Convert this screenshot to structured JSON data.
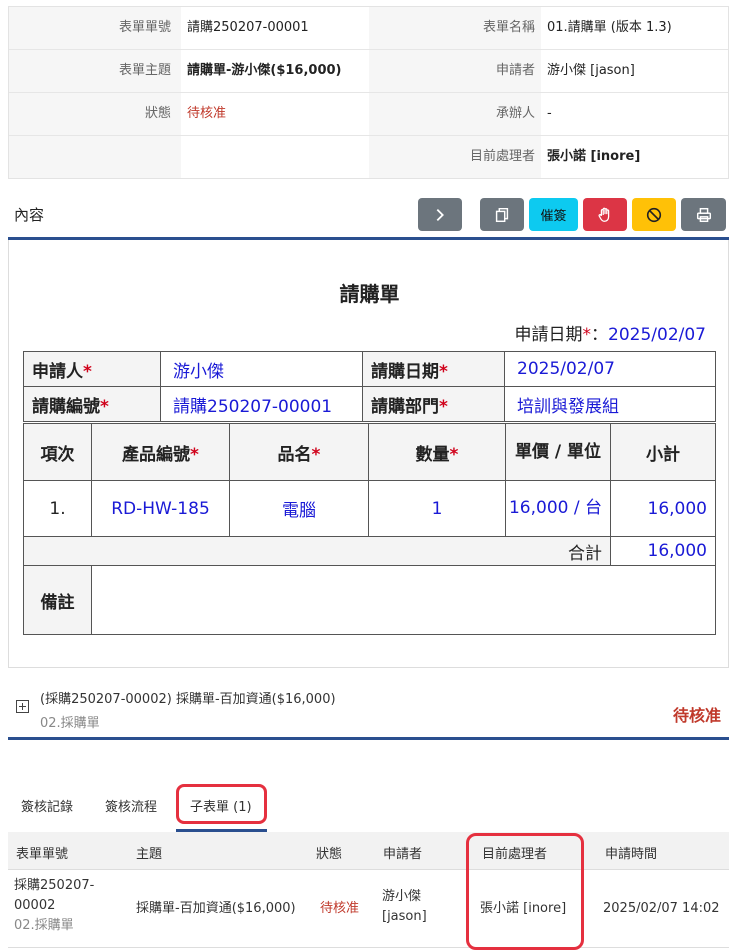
{
  "info": {
    "form_no_label": "表單單號",
    "form_no": "請購250207-00001",
    "form_name_label": "表單名稱",
    "form_name": "01.請購單 (版本 1.3)",
    "subject_label": "表單主題",
    "subject": "請購單-游小傑($16,000)",
    "applicant_label": "申請者",
    "applicant": "游小傑 [jason]",
    "status_label": "狀態",
    "status": "待核准",
    "handler_label": "承辦人",
    "handler": "-",
    "current_label": "目前處理者",
    "current": "張小諾 [inore]"
  },
  "content": {
    "title": "內容",
    "urge_label": "催簽"
  },
  "form": {
    "title": "請購單",
    "apply_date_label": "申請日期",
    "colon": "：",
    "apply_date": "2025/02/07",
    "applicant_label": "申請人",
    "applicant": "游小傑",
    "req_date_label": "請購日期",
    "req_date": "2025/02/07",
    "req_no_label": "請購編號",
    "req_no": "請購250207-00001",
    "dept_label": "請購部門",
    "dept": "培訓與發展組",
    "cols": {
      "item": "項次",
      "product_no": "產品編號",
      "name": "品名",
      "qty": "數量",
      "unit_price": "單價 / 單位",
      "subtotal": "小計"
    },
    "rows": [
      {
        "item": "1.",
        "product_no": "RD-HW-185",
        "name": "電腦",
        "qty": "1",
        "unit_price": "16,000 / 台",
        "subtotal": "16,000"
      }
    ],
    "total_label": "合計",
    "total": "16,000",
    "note_label": "備註",
    "note": ""
  },
  "related": {
    "title": "(採購250207-00002) 採購單-百加資通($16,000)",
    "sub": "02.採購單",
    "status": "待核准"
  },
  "tabs": [
    {
      "label": "簽核記錄"
    },
    {
      "label": "簽核流程"
    },
    {
      "label": "子表單 (1)"
    }
  ],
  "subforms": {
    "headers": {
      "no": "表單單號",
      "subject": "主題",
      "status": "狀態",
      "applicant": "申請者",
      "current": "目前處理者",
      "time": "申請時間"
    },
    "row": {
      "no_line1": "採購250207-",
      "no_line2": "00002",
      "form_type": "02.採購單",
      "subject": "採購單-百加資通($16,000)",
      "status": "待核准",
      "applicant_line1": "游小傑",
      "applicant_line2": "[jason]",
      "current": "張小諾 [inore]",
      "time": "2025/02/07 14:02"
    }
  }
}
